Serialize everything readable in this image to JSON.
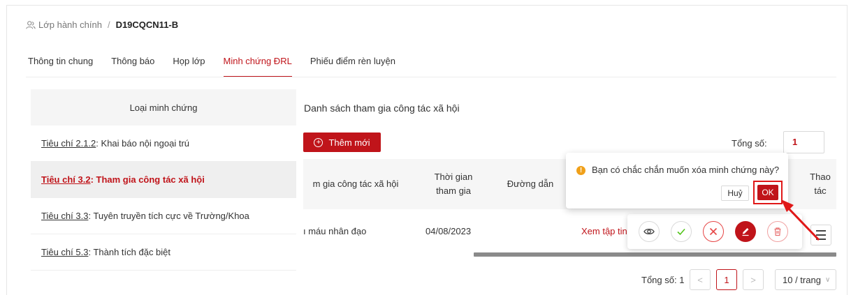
{
  "breadcrumb": {
    "parent": "Lớp hành chính",
    "separator": "/",
    "current": "D19CQCN11-B"
  },
  "tabs": [
    {
      "label": "Thông tin chung",
      "active": false
    },
    {
      "label": "Thông báo",
      "active": false
    },
    {
      "label": "Họp lớp",
      "active": false
    },
    {
      "label": "Minh chứng ĐRL",
      "active": true
    },
    {
      "label": "Phiếu điểm rèn luyện",
      "active": false
    }
  ],
  "left_panel": {
    "header": "Loại minh chứng",
    "items": [
      {
        "code": "Tiêu chí 2.1.2",
        "label": ": Khai báo nội ngoại trú",
        "active": false
      },
      {
        "code": "Tiêu chí 3.2",
        "label": ": Tham gia công tác xã hội",
        "active": true
      },
      {
        "code": "Tiêu chí 3.3",
        "label": ": Tuyên truyền tích cực về Trường/Khoa",
        "active": false
      },
      {
        "code": "Tiêu chí 5.3",
        "label": ": Thành tích đặc biệt",
        "active": false
      }
    ]
  },
  "content": {
    "title": "Danh sách tham gia công tác xã hội",
    "add_button": "Thêm mới",
    "total_label": "Tổng số:",
    "total_value": "1"
  },
  "table": {
    "headers": {
      "activity": "m gia công tác xã hội",
      "time_line1": "Thời gian",
      "time_line2": "tham gia",
      "link": "Đường dẫn",
      "actions_line1": "Thao",
      "actions_line2": "tác"
    },
    "rows": [
      {
        "activity": "ı máu nhân đạo",
        "date": "04/08/2023",
        "link": "Xem tập tin"
      }
    ]
  },
  "popconfirm": {
    "message": "Bạn có chắc chắn muốn xóa minh chứng này?",
    "cancel": "Huỷ",
    "ok": "OK"
  },
  "pagination": {
    "total_label": "Tổng số: 1",
    "prev": "<",
    "current": "1",
    "next": ">",
    "page_size": "10 / trang"
  },
  "colors": {
    "accent": "#c0141a",
    "warning": "#f0a019",
    "highlight_box": "#e01818",
    "success": "#52c41a"
  },
  "icons": {
    "breadcrumb": "users-icon",
    "add": "plus-circle-icon",
    "view": "eye-icon",
    "approve": "check-icon",
    "reject": "close-icon",
    "edit": "edit-icon",
    "delete": "trash-icon",
    "menu": "menu-icon",
    "warning": "exclamation-circle-icon"
  }
}
